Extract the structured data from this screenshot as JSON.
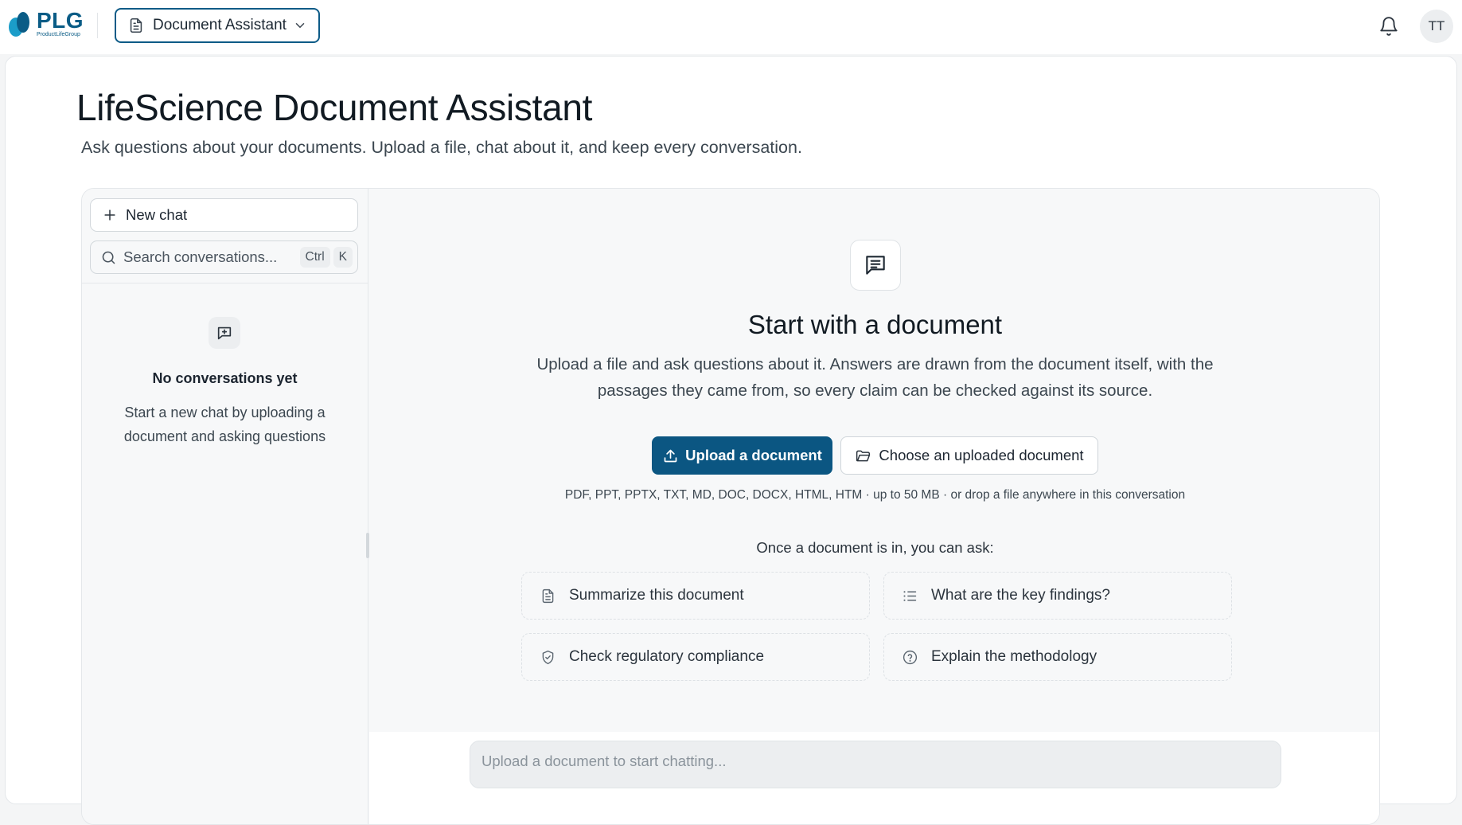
{
  "topbar": {
    "logo_text": "PLG",
    "logo_subtext": "ProductLifeGroup",
    "app_switcher_label": "Document Assistant",
    "avatar_initials": "TT"
  },
  "page": {
    "title": "LifeScience Document Assistant",
    "subtitle": "Ask questions about your documents. Upload a file, chat about it, and keep every conversation."
  },
  "sidebar": {
    "new_chat_label": "New chat",
    "search_placeholder": "Search conversations...",
    "shortcut_keys": [
      "Ctrl",
      "K"
    ],
    "empty_title": "No conversations yet",
    "empty_description": "Start a new chat by uploading a document and asking questions"
  },
  "chat": {
    "hero_title": "Start with a document",
    "hero_description": "Upload a file and ask questions about it. Answers are drawn from the document itself, with the passages they came from, so every claim can be checked against its source.",
    "upload_button_label": "Upload a document",
    "choose_button_label": "Choose an uploaded document",
    "supported_formats": "PDF, PPT, PPTX, TXT, MD, DOC, DOCX, HTML, HTM · up to 50 MB · or drop a file anywhere in this conversation",
    "suggestions_heading": "Once a document is in, you can ask:",
    "suggestions": [
      {
        "label": "Summarize this document",
        "icon": "document-icon"
      },
      {
        "label": "What are the key findings?",
        "icon": "list-icon"
      },
      {
        "label": "Check regulatory compliance",
        "icon": "shield-check-icon"
      },
      {
        "label": "Explain the methodology",
        "icon": "question-circle-icon"
      }
    ],
    "composer_placeholder": "Upload a document to start chatting..."
  },
  "colors": {
    "brand_primary": "#0b5682",
    "app_switcher_border": "#0d5b87",
    "logo_accent": "#1b9dc9"
  }
}
